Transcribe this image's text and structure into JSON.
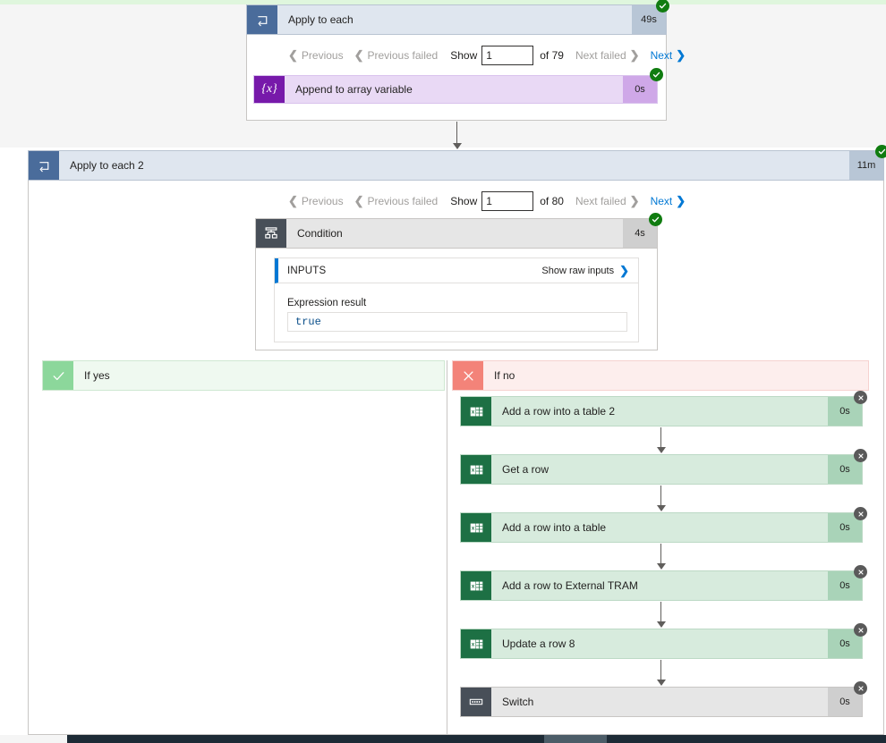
{
  "theme": {
    "accent_blue": "#0078d4",
    "success_green": "#107c10",
    "skipped_gray": "#5a5a5a",
    "loop_header_bg": "#dfe6ef",
    "loop_icon_bg": "#4a6c9b",
    "variable_icon_bg": "#7719aa",
    "excel_icon_bg": "#1d7044",
    "control_icon_bg": "#484f58",
    "if_yes_bg": "#eff9f0",
    "if_no_bg": "#fdeeed"
  },
  "apply_to_each_1": {
    "title": "Apply to each",
    "icon": "loop-icon",
    "duration": "49s",
    "status": "succeeded",
    "status_icon": "check-circle-icon",
    "pager": {
      "previous": "Previous",
      "previous_failed": "Previous failed",
      "show_label": "Show",
      "page_value": "1",
      "of_label": "of 79",
      "next_failed": "Next failed",
      "next": "Next"
    },
    "actions": [
      {
        "title": "Append to array variable",
        "icon": "variable-icon",
        "icon_glyph": "{x}",
        "duration": "0s",
        "status": "succeeded",
        "status_icon": "check-circle-icon"
      }
    ]
  },
  "apply_to_each_2": {
    "title": "Apply to each 2",
    "icon": "loop-icon",
    "duration": "11m",
    "status": "succeeded",
    "status_icon": "check-circle-icon",
    "pager": {
      "previous": "Previous",
      "previous_failed": "Previous failed",
      "show_label": "Show",
      "page_value": "1",
      "of_label": "of 80",
      "next_failed": "Next failed",
      "next": "Next"
    },
    "condition": {
      "title": "Condition",
      "icon": "condition-icon",
      "duration": "4s",
      "status": "succeeded",
      "status_icon": "check-circle-icon",
      "inputs": {
        "heading": "INPUTS",
        "show_raw_inputs": "Show raw inputs",
        "chevron": "chevron-right-icon",
        "expression_result_label": "Expression result",
        "expression_result_value": "true"
      }
    },
    "branch_yes": {
      "label": "If yes",
      "icon": "checkmark-icon",
      "actions": []
    },
    "branch_no": {
      "label": "If no",
      "icon": "cross-icon",
      "actions": [
        {
          "title": "Add a row into a table 2",
          "icon": "excel-icon",
          "duration": "0s",
          "status": "skipped",
          "status_icon": "x-circle-icon",
          "kind": "excel"
        },
        {
          "title": "Get a row",
          "icon": "excel-icon",
          "duration": "0s",
          "status": "skipped",
          "status_icon": "x-circle-icon",
          "kind": "excel"
        },
        {
          "title": "Add a row into a table",
          "icon": "excel-icon",
          "duration": "0s",
          "status": "skipped",
          "status_icon": "x-circle-icon",
          "kind": "excel"
        },
        {
          "title": "Add a row to External TRAM",
          "icon": "excel-icon",
          "duration": "0s",
          "status": "skipped",
          "status_icon": "x-circle-icon",
          "kind": "excel"
        },
        {
          "title": "Update a row 8",
          "icon": "excel-icon",
          "duration": "0s",
          "status": "skipped",
          "status_icon": "x-circle-icon",
          "kind": "excel"
        },
        {
          "title": "Switch",
          "icon": "switch-icon",
          "duration": "0s",
          "status": "skipped",
          "status_icon": "x-circle-icon",
          "kind": "control"
        }
      ]
    }
  }
}
